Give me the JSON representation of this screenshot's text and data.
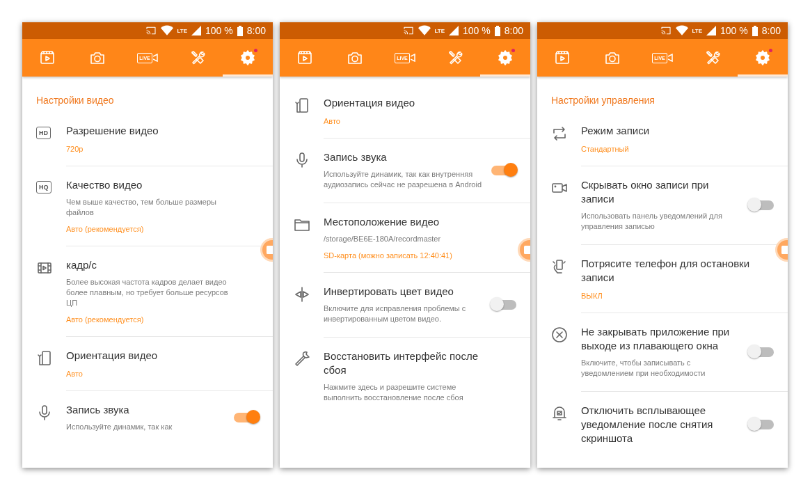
{
  "phones": [
    {
      "status_bar": {
        "network": "LTE",
        "battery": "100 %",
        "time": "8:00"
      },
      "tabs": [
        {
          "kind": "clips",
          "selected": false
        },
        {
          "kind": "camera",
          "selected": false
        },
        {
          "kind": "live",
          "text": "LIVE",
          "selected": false
        },
        {
          "kind": "tools",
          "selected": false
        },
        {
          "kind": "settings",
          "selected": true,
          "badge": true
        }
      ],
      "items": [
        {
          "kind": "header",
          "title": "Настройки видео"
        },
        {
          "kind": "hd",
          "icon_text": "HD",
          "title": "Разрешение видео",
          "value": "720p"
        },
        {
          "kind": "hq",
          "icon_text": "HQ",
          "title": "Качество видео",
          "description": "Чем выше качество, тем больше размеры файлов",
          "value": "Авто (рекомендуется)"
        },
        {
          "kind": "film",
          "title": "кадр/с",
          "description": "Более высокая частота кадров делает видео более плавным, но требует больше ресурсов ЦП",
          "value": "Авто (рекомендуется)"
        },
        {
          "kind": "rotate",
          "title": "Ориентация видео",
          "value": "Авто"
        },
        {
          "kind": "mic",
          "title": "Запись звука",
          "description": "Используйте динамик, так как",
          "switch_on": true
        }
      ]
    },
    {
      "status_bar": {
        "network": "LTE",
        "battery": "100 %",
        "time": "8:00"
      },
      "tabs": [
        {
          "kind": "clips",
          "selected": false
        },
        {
          "kind": "camera",
          "selected": false
        },
        {
          "kind": "live",
          "text": "LIVE",
          "selected": false
        },
        {
          "kind": "tools",
          "selected": false
        },
        {
          "kind": "settings",
          "selected": true,
          "badge": true
        }
      ],
      "items": [
        {
          "kind": "rotate",
          "title": "Ориентация видео",
          "value": "Авто"
        },
        {
          "kind": "mic",
          "title": "Запись звука",
          "description": "Используйте динамик, так как внутренняя аудиозапись сейчас не разрешена в Android",
          "switch_on": true
        },
        {
          "kind": "folder",
          "title": "Местоположение видео",
          "description": "/storage/BE6E-180A/recordmaster",
          "value": "SD-карта (можно записать 12:40:41)"
        },
        {
          "kind": "invert",
          "title": "Инвертировать цвет видео",
          "description": "Включите для исправления проблемы с инвертированным цветом видео.",
          "switch_on": false
        },
        {
          "kind": "wrench",
          "title": "Восстановить интерфейс после сбоя",
          "description": "Нажмите здесь и разрешите системе выполнить восстановление после сбоя"
        }
      ]
    },
    {
      "status_bar": {
        "network": "LTE",
        "battery": "100 %",
        "time": "8:00"
      },
      "tabs": [
        {
          "kind": "clips",
          "selected": false
        },
        {
          "kind": "camera",
          "selected": false
        },
        {
          "kind": "live",
          "text": "LIVE",
          "selected": false
        },
        {
          "kind": "tools",
          "selected": false
        },
        {
          "kind": "settings",
          "selected": true,
          "badge": true
        }
      ],
      "items": [
        {
          "kind": "header",
          "title": "Настройки управления"
        },
        {
          "kind": "repeat",
          "title": "Режим записи",
          "value": "Стандартный"
        },
        {
          "kind": "videocam",
          "title": "Скрывать окно записи при записи",
          "description": "Использовать панель уведомлений для управления записью",
          "switch_on": false
        },
        {
          "kind": "shake",
          "title": "Потрясите телефон для остановки записи",
          "value": "ВЫКЛ"
        },
        {
          "kind": "close",
          "title": "Не закрывать приложение при выходе из плавающего окна",
          "description": "Включите, чтобы записывать с уведомлением при необходимости",
          "switch_on": false
        },
        {
          "kind": "bell",
          "title": "Отключить всплывающее уведомление после снятия скриншота",
          "switch_on": false
        }
      ]
    }
  ]
}
